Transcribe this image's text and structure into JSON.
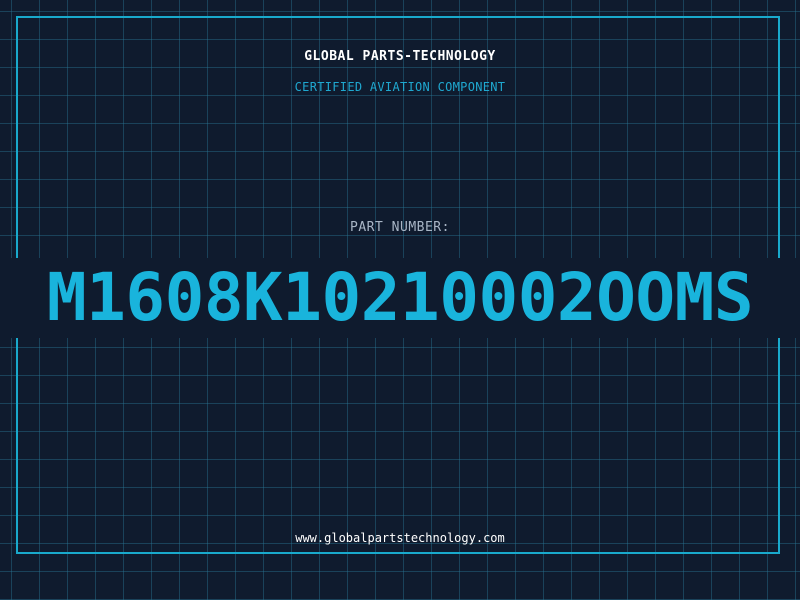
{
  "header": {
    "company_name": "GLOBAL PARTS-TECHNOLOGY",
    "subtitle": "CERTIFIED AVIATION COMPONENT"
  },
  "part": {
    "label": "PART NUMBER:",
    "number": "M1608K10210002OOMS"
  },
  "footer": {
    "website": "www.globalpartstechnology.com"
  },
  "colors": {
    "background": "#0f1b2e",
    "grid": "#287896",
    "accent": "#19b4dc",
    "title_text": "#ffffff",
    "label_text": "#a9b6c6"
  }
}
